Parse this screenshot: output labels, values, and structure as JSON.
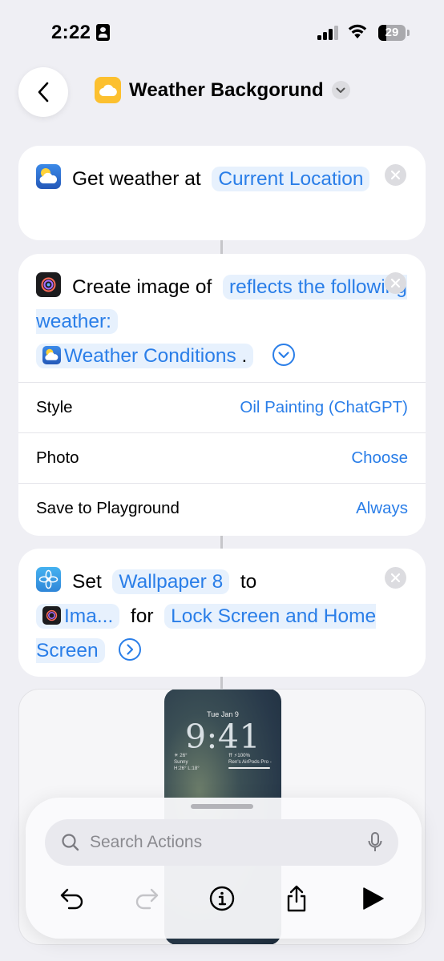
{
  "status_bar": {
    "time": "2:22",
    "battery": "29"
  },
  "header": {
    "title": "Weather Backgorund"
  },
  "actions": [
    {
      "text": "Get weather at",
      "param": "Current Location"
    },
    {
      "text": "Create image of",
      "prompt": "reflects the following weather:",
      "variable": "Weather Conditions",
      "suffix": ".",
      "rows": [
        {
          "label": "Style",
          "value": "Oil Painting (ChatGPT)"
        },
        {
          "label": "Photo",
          "value": "Choose"
        },
        {
          "label": "Save to Playground",
          "value": "Always"
        }
      ]
    },
    {
      "text": "Set",
      "wallpaper": "Wallpaper 8",
      "to": "to",
      "image_var": "Ima...",
      "for": "for",
      "target": "Lock Screen and Home Screen"
    }
  ],
  "preview": {
    "date": "Tue Jan 9",
    "time": "9:41",
    "widget_left": [
      "☀ 26°",
      "Sunny",
      "H:26° L:18°"
    ],
    "widget_right": [
      "⇈ ⚡100%",
      "Ren's AirPods Pro -"
    ]
  },
  "search": {
    "placeholder": "Search Actions"
  },
  "colors": {
    "accent": "#2a7ee8",
    "pill_bg": "#e7f1fd",
    "background": "#efeff4",
    "shortcut_icon": "#fcc02f"
  }
}
